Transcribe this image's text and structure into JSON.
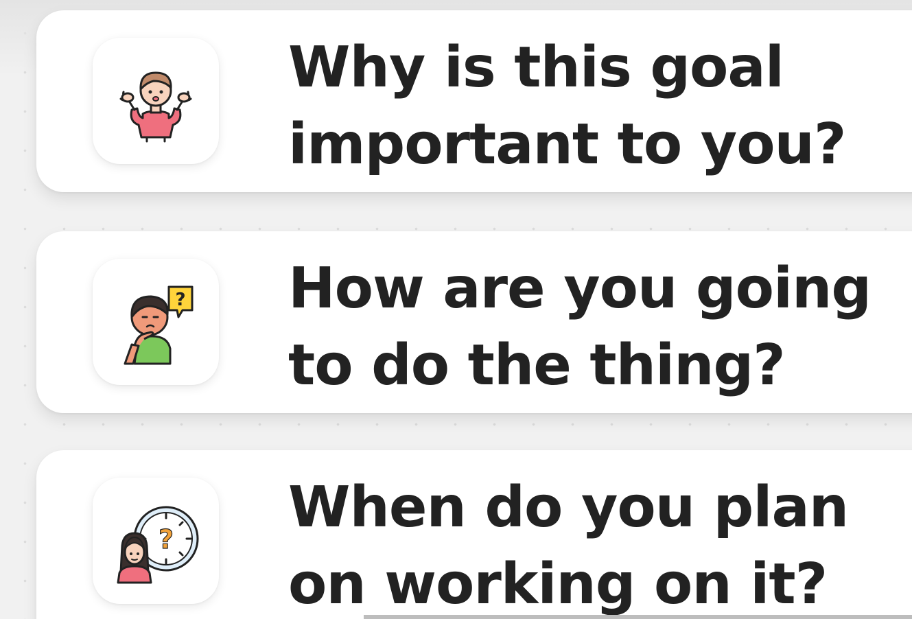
{
  "questions": [
    {
      "line1": "Why is this goal",
      "line2": "important to you?",
      "icon": "shrugging-person-icon"
    },
    {
      "line1": "How are you going",
      "line2": "to do the thing?",
      "icon": "thinking-person-icon"
    },
    {
      "line1": "When do you plan",
      "line2": "on working on it?",
      "icon": "person-clock-question-icon"
    }
  ],
  "icon_glyphs": {
    "question_mark": "?"
  },
  "colors": {
    "text": "#222222",
    "card": "#ffffff",
    "background": "#f1f1f1",
    "shirt_pink": "#ef6f7e",
    "shirt_green": "#7cc85b",
    "skin": "#f8d3bd",
    "hair_brown": "#8c5a3c",
    "speech_yellow": "#ffd43b",
    "clock_blue": "#dfeef9"
  }
}
